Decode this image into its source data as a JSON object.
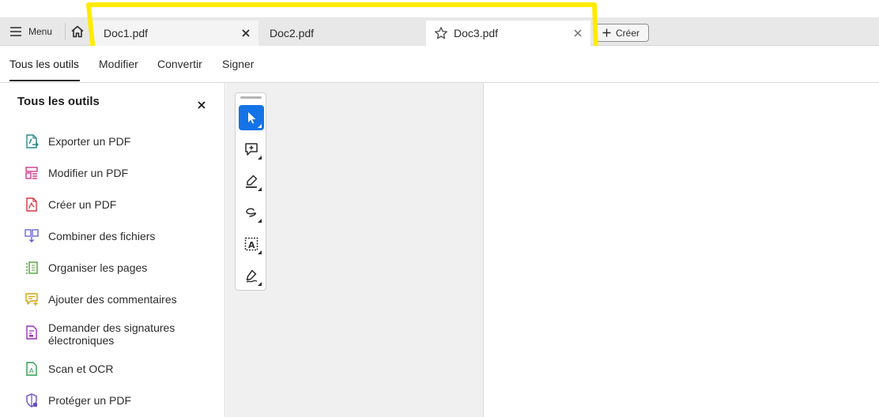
{
  "menu": {
    "label": "Menu",
    "icon": "hamburger-icon"
  },
  "tabs": [
    {
      "label": "Doc1.pdf",
      "active": false
    },
    {
      "label": "Doc2.pdf",
      "active": false
    },
    {
      "label": "Doc3.pdf",
      "active": true
    }
  ],
  "create_button": {
    "label": "Créer"
  },
  "nav": {
    "items": [
      {
        "label": "Tous les outils",
        "active": true
      },
      {
        "label": "Modifier"
      },
      {
        "label": "Convertir"
      },
      {
        "label": "Signer"
      }
    ]
  },
  "panel": {
    "title": "Tous les outils",
    "tools": [
      {
        "label": "Exporter un PDF",
        "icon": "export-pdf-icon",
        "color": "#2a8a8a"
      },
      {
        "label": "Modifier un PDF",
        "icon": "edit-pdf-icon",
        "color": "#d13a8a"
      },
      {
        "label": "Créer un PDF",
        "icon": "create-pdf-icon",
        "color": "#d9363e"
      },
      {
        "label": "Combiner des fichiers",
        "icon": "combine-files-icon",
        "color": "#5d5fd1"
      },
      {
        "label": "Organiser les pages",
        "icon": "organize-pages-icon",
        "color": "#4fa33b"
      },
      {
        "label": "Ajouter des commentaires",
        "icon": "comment-icon",
        "color": "#d5a40a"
      },
      {
        "label": "Demander des signatures électroniques",
        "label_line1": "Demander des signatures",
        "label_line2": "électroniques",
        "icon": "request-signatures-icon",
        "color": "#9c2fbf"
      },
      {
        "label": "Scan et OCR",
        "icon": "scan-ocr-icon",
        "color": "#2f9d4f"
      },
      {
        "label": "Protéger un PDF",
        "icon": "protect-pdf-icon",
        "color": "#6a4cc4"
      }
    ]
  },
  "toolbar": {
    "tools": [
      {
        "name": "select-tool",
        "icon": "cursor-icon",
        "active": true
      },
      {
        "name": "add-comment-tool",
        "icon": "comment-plus-icon"
      },
      {
        "name": "highlight-tool",
        "icon": "marker-icon"
      },
      {
        "name": "draw-tool",
        "icon": "freehand-icon"
      },
      {
        "name": "text-recognition-tool",
        "icon": "text-box-icon"
      },
      {
        "name": "sign-tool",
        "icon": "pen-sign-icon"
      }
    ]
  },
  "colors": {
    "accent": "#1473e6",
    "highlight": "#ffeb00"
  }
}
